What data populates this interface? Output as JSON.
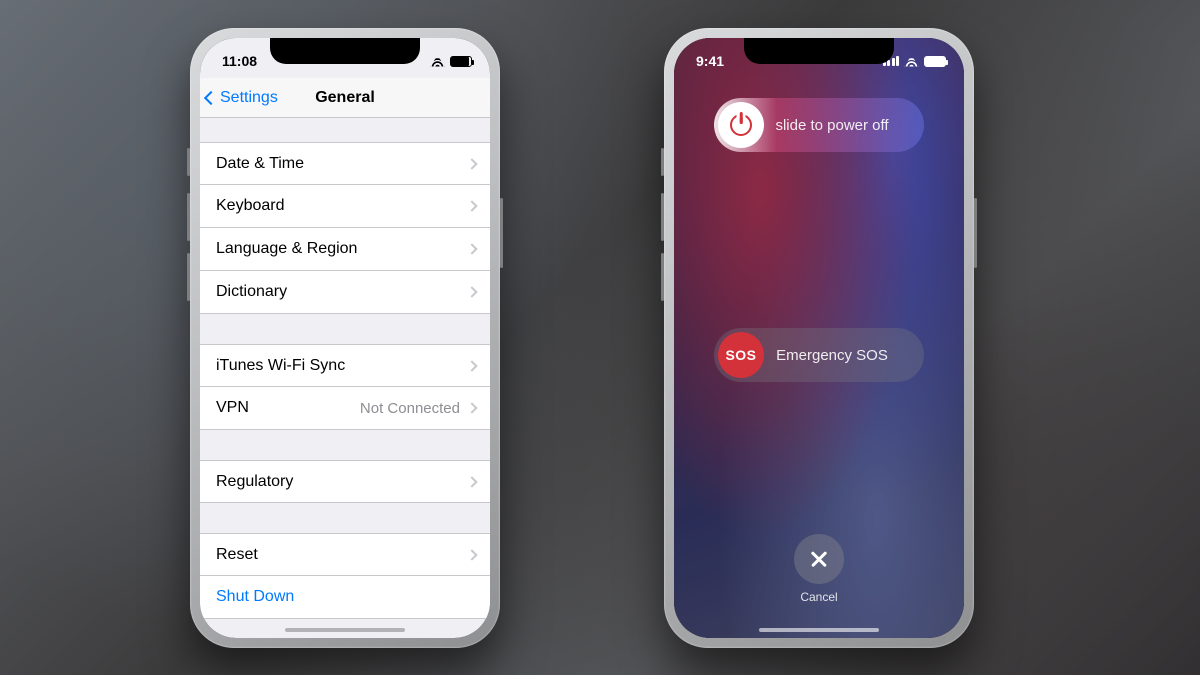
{
  "left_phone": {
    "status": {
      "time": "11:08"
    },
    "nav": {
      "back_label": "Settings",
      "title": "General"
    },
    "groups": [
      {
        "cells": [
          {
            "label": "Date & Time"
          },
          {
            "label": "Keyboard"
          },
          {
            "label": "Language & Region"
          },
          {
            "label": "Dictionary"
          }
        ]
      },
      {
        "cells": [
          {
            "label": "iTunes Wi-Fi Sync"
          },
          {
            "label": "VPN",
            "detail": "Not Connected"
          }
        ]
      },
      {
        "cells": [
          {
            "label": "Regulatory"
          }
        ]
      },
      {
        "cells": [
          {
            "label": "Reset"
          },
          {
            "label": "Shut Down",
            "link": true,
            "no_chevron": true
          }
        ]
      }
    ]
  },
  "right_phone": {
    "status": {
      "time": "9:41"
    },
    "power_slider_label": "slide to power off",
    "sos_knob_label": "SOS",
    "sos_slider_label": "Emergency SOS",
    "cancel_label": "Cancel"
  }
}
